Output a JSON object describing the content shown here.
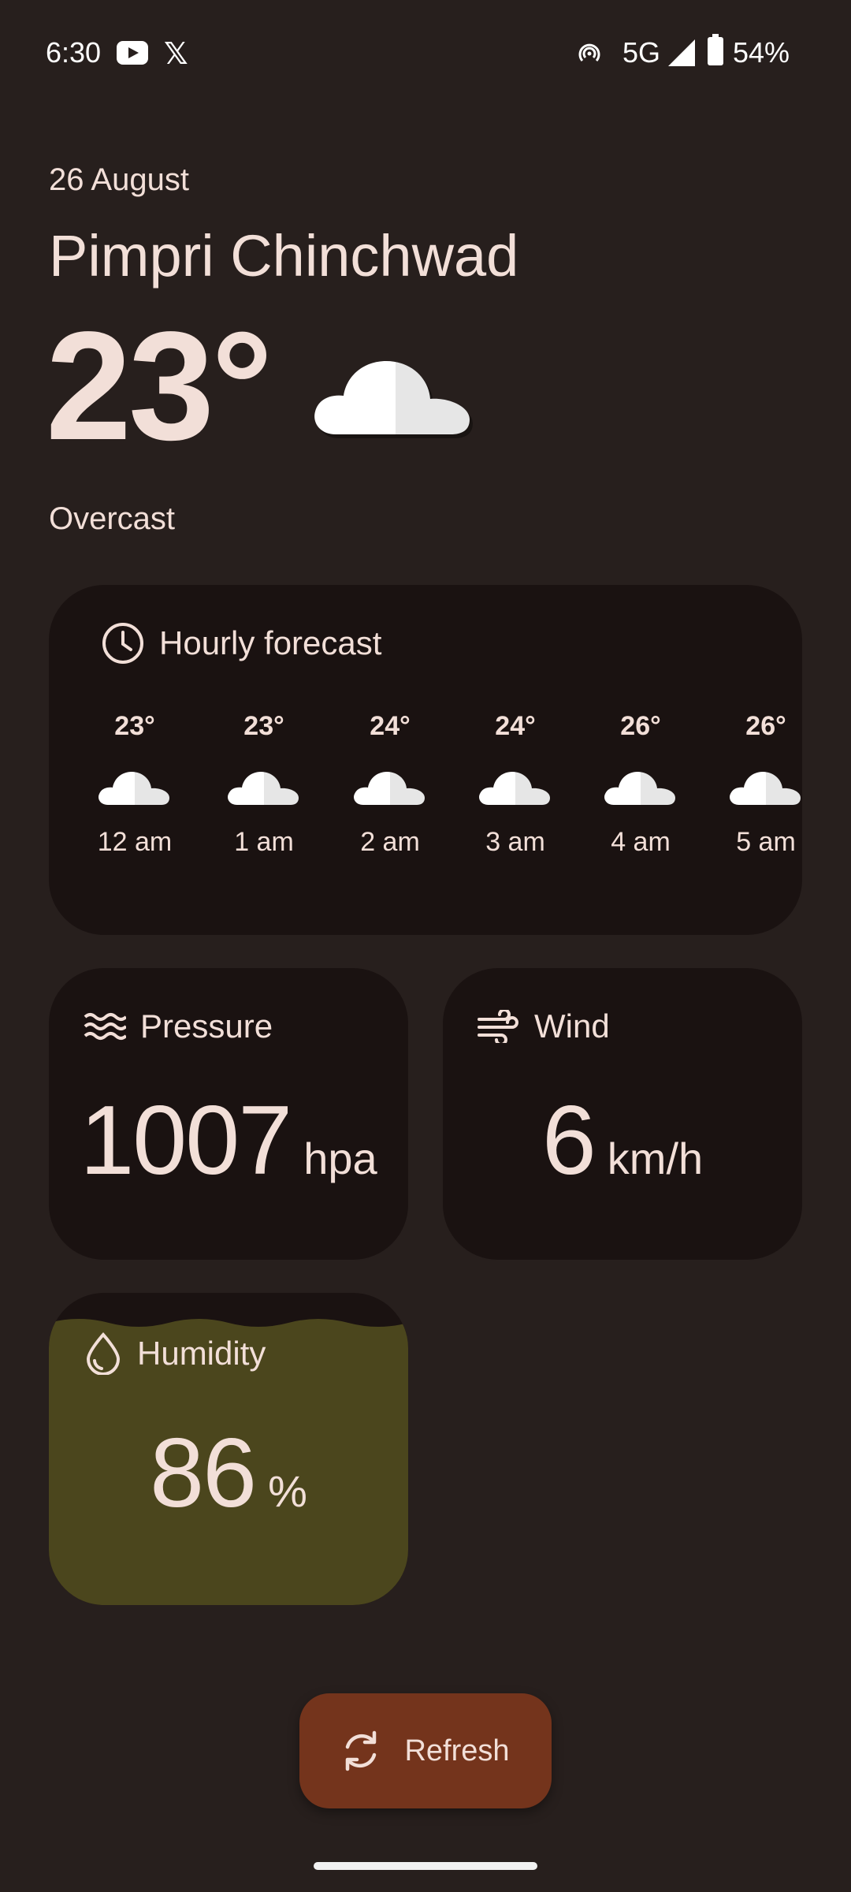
{
  "status_bar": {
    "time": "6:30",
    "x_app_label": "𝕏",
    "network": "5G",
    "battery": "54%"
  },
  "header": {
    "date": "26 August",
    "city": "Pimpri Chinchwad",
    "temperature": "23°",
    "condition": "Overcast",
    "condition_icon": "cloud-icon"
  },
  "hourly": {
    "title": "Hourly forecast",
    "icon": "clock-icon",
    "items": [
      {
        "temp": "23°",
        "time": "12 am"
      },
      {
        "temp": "23°",
        "time": "1 am"
      },
      {
        "temp": "24°",
        "time": "2 am"
      },
      {
        "temp": "24°",
        "time": "3 am"
      },
      {
        "temp": "26°",
        "time": "4 am"
      },
      {
        "temp": "26°",
        "time": "5 am"
      }
    ]
  },
  "pressure": {
    "title": "Pressure",
    "icon": "waves-icon",
    "value": "1007",
    "unit": "hpa"
  },
  "wind": {
    "title": "Wind",
    "icon": "wind-icon",
    "value": "6",
    "unit": "km/h"
  },
  "humidity": {
    "title": "Humidity",
    "icon": "water-drop-icon",
    "value": "86",
    "unit": "%",
    "fill_fraction": 0.86
  },
  "refresh": {
    "label": "Refresh",
    "icon": "refresh-icon"
  },
  "colors": {
    "background": "#271f1d",
    "card": "#1a1211",
    "text": "#f2dfd8",
    "humidity_fill": "#4b461d",
    "refresh_button": "#74341c"
  }
}
